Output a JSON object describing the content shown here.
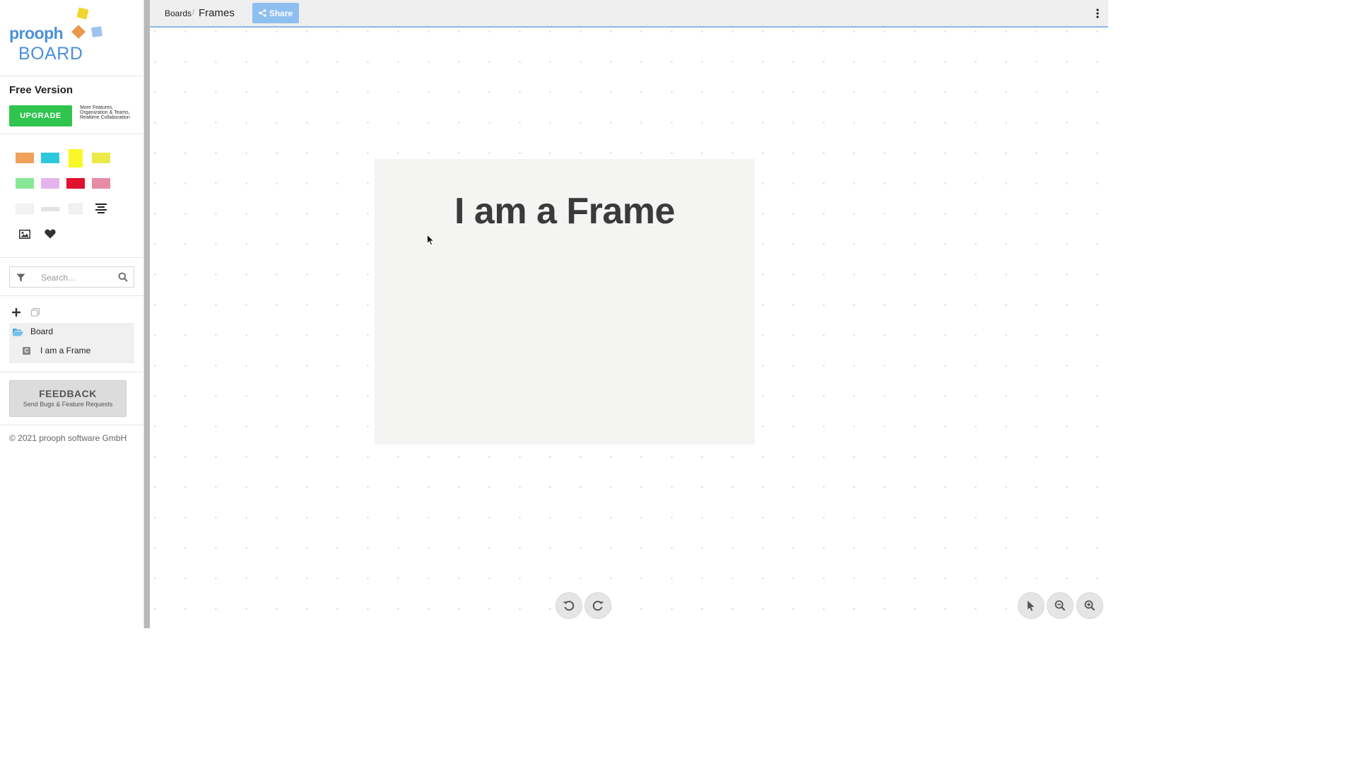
{
  "logo": {
    "word1": "prooph",
    "word2": "BOARD"
  },
  "plan": {
    "title": "Free Version",
    "upgrade_label": "UPGRADE",
    "description": "More Features, Organization & Teams, Realtime Collaboration"
  },
  "palette": {
    "colors": [
      "#f0a05a",
      "#2ec8dd",
      "#f8f826",
      "#ece94b",
      "#86e895",
      "#e6b4ec",
      "#e0102e",
      "#e68ca4"
    ],
    "tool_icons": [
      "sticky-note-white",
      "text-line",
      "frame-tool",
      "align-text",
      "image-icon",
      "heart-icon"
    ]
  },
  "search": {
    "placeholder": "Search..."
  },
  "tree": {
    "folder_label": "Board",
    "items": [
      {
        "label": "I am a Frame",
        "badge": "C"
      }
    ]
  },
  "feedback": {
    "title": "FEEDBACK",
    "subtitle": "Send Bugs & Feature Requests"
  },
  "copyright": "© 2021 prooph software GmbH",
  "breadcrumb": {
    "root": "Boards",
    "separator": "/",
    "current": "Frames"
  },
  "share_label": "Share",
  "frame": {
    "title": "I am a Frame"
  }
}
